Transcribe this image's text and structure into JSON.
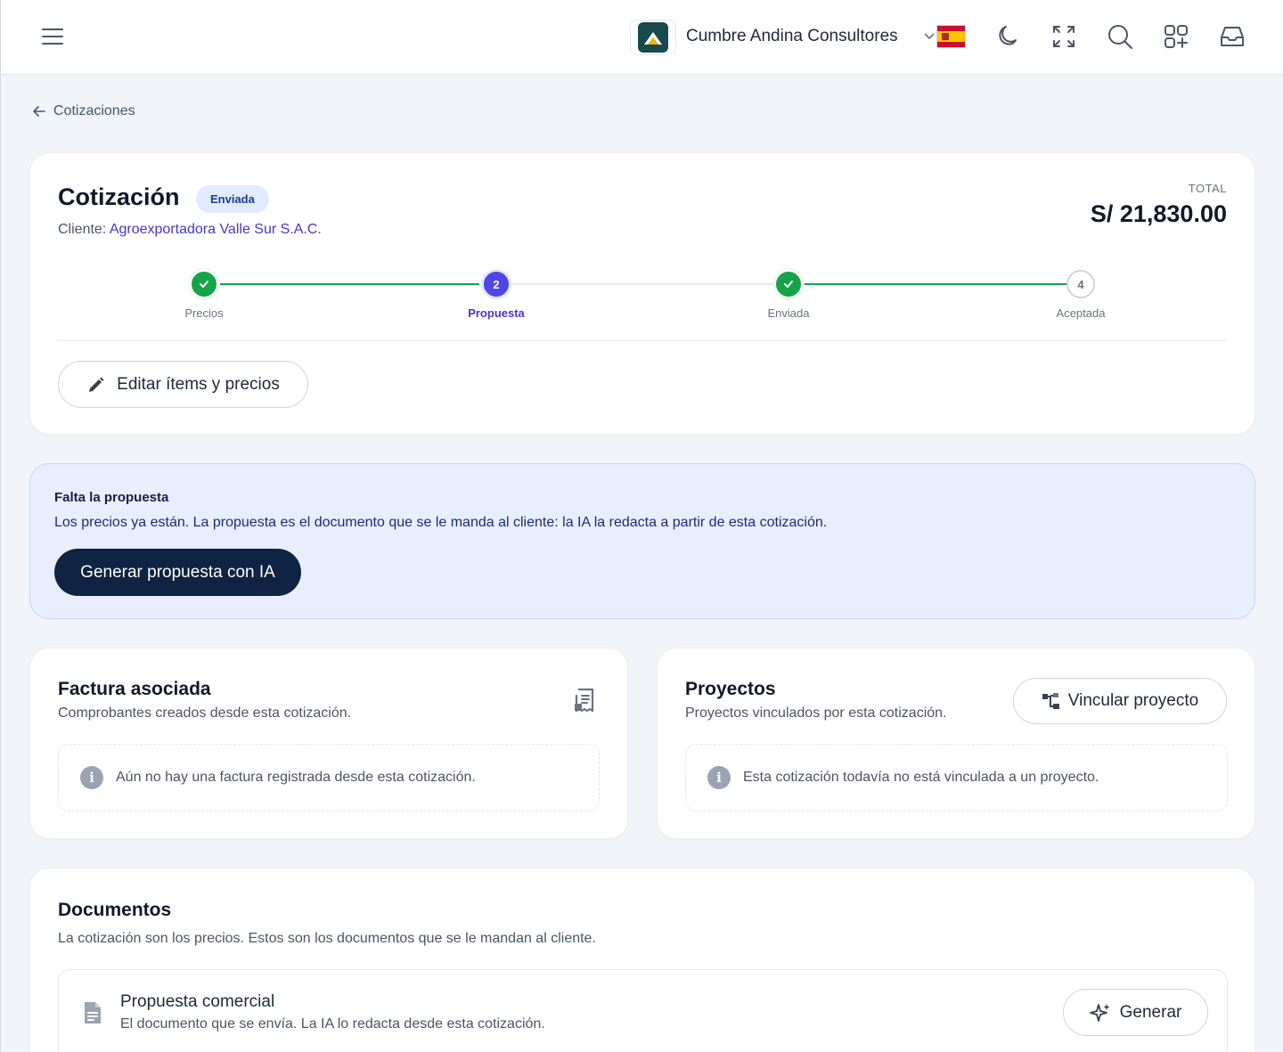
{
  "topbar": {
    "org_name": "Cumbre Andina Consultores",
    "accent": "#17494d",
    "icons": [
      "menu-icon",
      "chevron-down-icon",
      "spain-flag-icon",
      "moon-icon",
      "fullscreen-icon",
      "search-icon",
      "apps-grid-icon",
      "inbox-icon"
    ]
  },
  "breadcrumb": {
    "label": "Cotizaciones"
  },
  "quote": {
    "title": "Cotización",
    "status": "Enviada",
    "client_prefix": "Cliente:",
    "client_name": "Agroexportadora Valle Sur S.A.C.",
    "total_label": "TOTAL",
    "total_value": "S/ 21,830.00",
    "steps": [
      {
        "label": "Precios",
        "state": "done"
      },
      {
        "label": "Propuesta",
        "state": "current",
        "number": "2"
      },
      {
        "label": "Enviada",
        "state": "done"
      },
      {
        "label": "Aceptada",
        "state": "todo",
        "number": "4"
      }
    ],
    "edit_button": "Editar ítems y precios"
  },
  "alert": {
    "title": "Falta la propuesta",
    "text": "Los precios ya están. La propuesta es el documento que se le manda al cliente: la IA la redacta a partir de esta cotización.",
    "button": "Generar propuesta con IA"
  },
  "invoice": {
    "title": "Factura asociada",
    "subtitle": "Comprobantes creados desde esta cotización.",
    "empty": "Aún no hay una factura registrada desde esta cotización."
  },
  "projects": {
    "title": "Proyectos",
    "subtitle": "Proyectos vinculados por esta cotización.",
    "button": "Vincular proyecto",
    "empty": "Esta cotización todavía no está vinculada a un proyecto."
  },
  "documents": {
    "title": "Documentos",
    "subtitle": "La cotización son los precios. Estos son los documentos que se le mandan al cliente.",
    "items": [
      {
        "title": "Propuesta comercial",
        "subtitle": "El documento que se envía. La IA lo redacta desde esta cotización.",
        "button": "Generar"
      }
    ]
  },
  "colors": {
    "success": "#16a34a",
    "primary": "#4f46e5",
    "dark_button": "#0f2342",
    "alert_bg": "#e9eefd"
  }
}
